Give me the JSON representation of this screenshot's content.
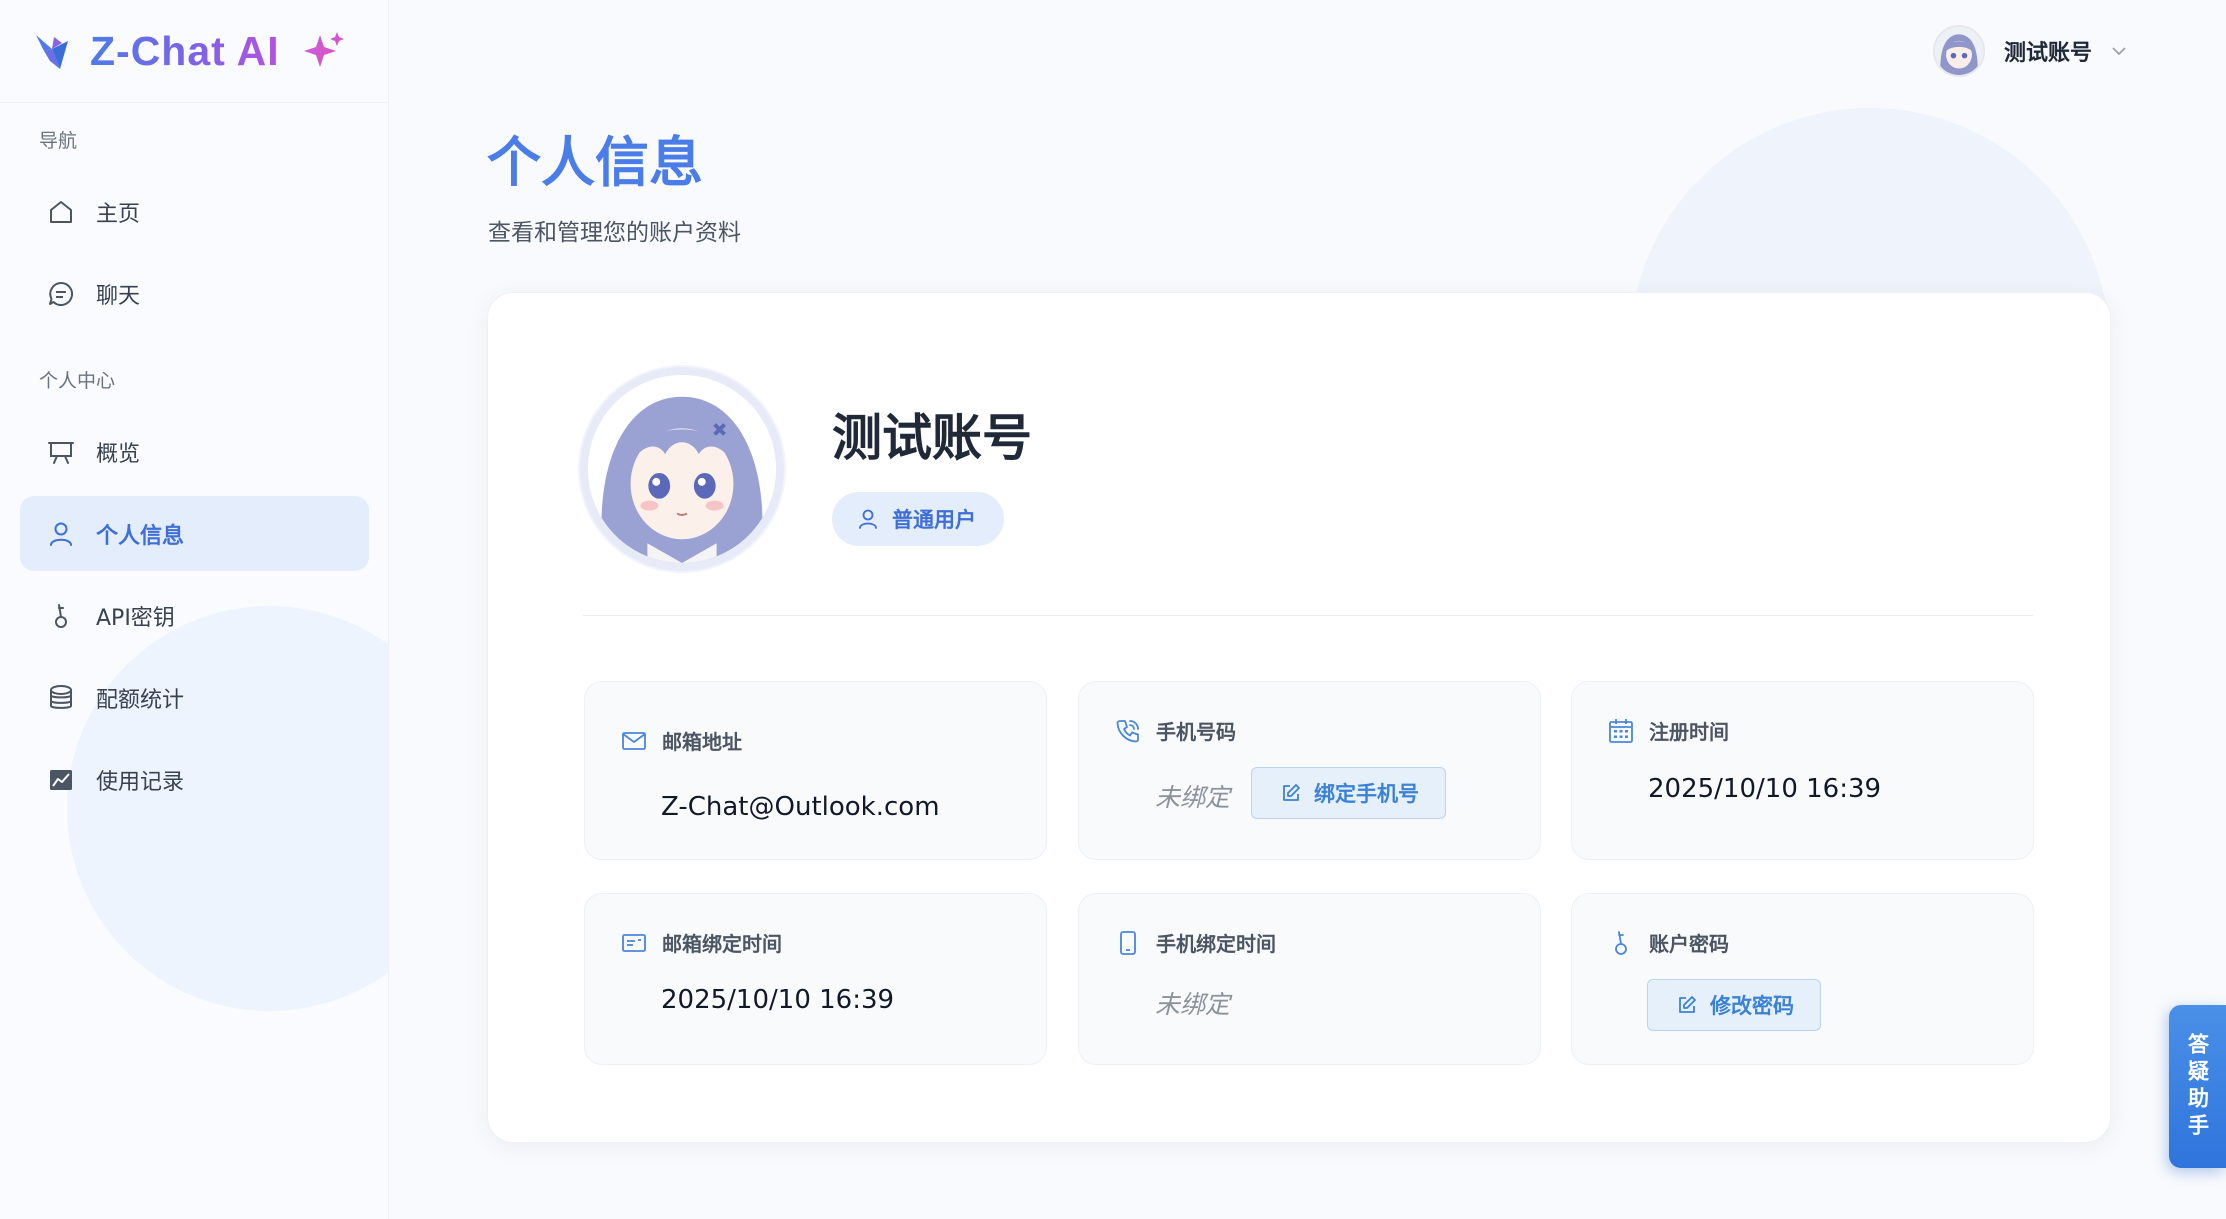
{
  "brand": {
    "name": "Z-Chat AI",
    "logo_icon": "origami-bird-icon",
    "sparkle_icon": "sparkle-icon"
  },
  "sidebar": {
    "sections": [
      {
        "title": "导航",
        "items": [
          {
            "label": "主页",
            "icon": "home-icon",
            "active": false
          },
          {
            "label": "聊天",
            "icon": "chat-bubble-icon",
            "active": false
          }
        ]
      },
      {
        "title": "个人中心",
        "items": [
          {
            "label": "概览",
            "icon": "presentation-board-icon",
            "active": false
          },
          {
            "label": "个人信息",
            "icon": "user-icon",
            "active": true
          },
          {
            "label": "API密钥",
            "icon": "key-icon",
            "active": false
          },
          {
            "label": "配额统计",
            "icon": "database-icon",
            "active": false
          },
          {
            "label": "使用记录",
            "icon": "chart-icon",
            "active": false
          }
        ]
      }
    ]
  },
  "header": {
    "username": "测试账号"
  },
  "page": {
    "title": "个人信息",
    "subtitle": "查看和管理您的账户资料"
  },
  "profile": {
    "name": "测试账号",
    "role": "普通用户"
  },
  "info": {
    "email": {
      "label": "邮箱地址",
      "value": "Z-Chat@Outlook.com"
    },
    "phone": {
      "label": "手机号码",
      "value": "未绑定",
      "action": "绑定手机号"
    },
    "register_time": {
      "label": "注册时间",
      "value": "2025/10/10  16:39"
    },
    "email_bind_time": {
      "label": "邮箱绑定时间",
      "value": "2025/10/10  16:39"
    },
    "phone_bind_time": {
      "label": "手机绑定时间",
      "value": "未绑定"
    },
    "password": {
      "label": "账户密码",
      "action": "修改密码"
    }
  },
  "helper": {
    "label": "答疑助手"
  },
  "colors": {
    "accent": "#4a7de8",
    "active_bg": "#e3edfc",
    "helper": "#3a82e0"
  }
}
